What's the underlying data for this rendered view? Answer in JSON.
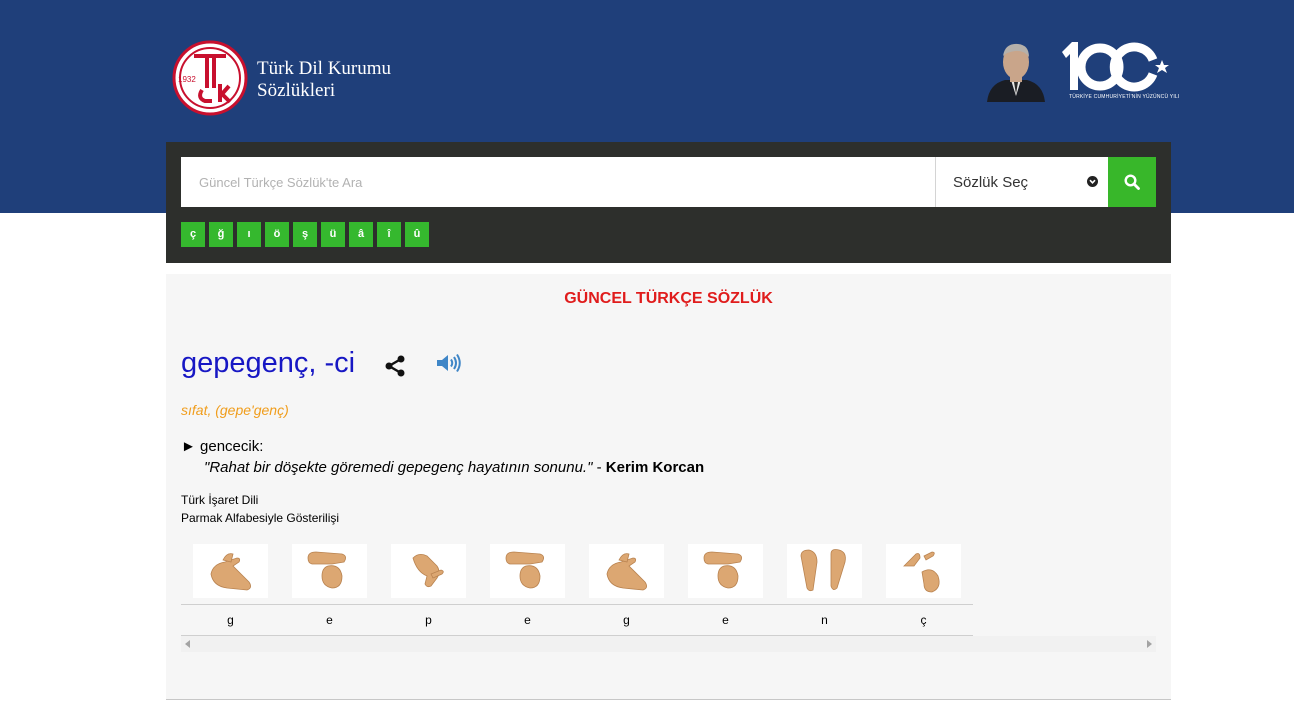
{
  "header": {
    "logo_year": "1932",
    "logo_monogram": "TDK",
    "title_line1": "Türk Dil Kurumu",
    "title_line2": "Sözlükleri",
    "centennial_mark": "100",
    "centennial_caption": "TÜRKİYE CUMHURİYETİ'NİN YÜZÜNCÜ YILI"
  },
  "search": {
    "placeholder": "Güncel Türkçe Sözlük'te Ara",
    "dictionary_select_label": "Sözlük Seç",
    "special_chars": [
      "ç",
      "ğ",
      "ı",
      "ö",
      "ş",
      "ü",
      "â",
      "î",
      "û"
    ]
  },
  "entry": {
    "dictionary_title": "GÜNCEL TÜRKÇE SÖZLÜK",
    "word": "gepegenç, -ci",
    "part_of_speech": "sıfat, (gepe'genç)",
    "meaning_marker": "►",
    "meaning": "gencecik:",
    "example_quote": "\"Rahat bir döşekte göremedi gepegenç hayatının sonunu.\"",
    "example_separator": " - ",
    "example_author": "Kerim Korcan"
  },
  "sign_language": {
    "title_line1": "Türk İşaret Dili",
    "title_line2": "Parmak Alfabesiyle Gösterilişi",
    "letters": [
      "g",
      "e",
      "p",
      "e",
      "g",
      "e",
      "n",
      "ç"
    ]
  },
  "colors": {
    "banner": "#1f3f7a",
    "search_panel": "#2d2f2c",
    "accent_green": "#38b72a",
    "dictionary_title": "#e01c1c",
    "word": "#1717c4",
    "part_of_speech": "#f09d1c",
    "speaker": "#3f86c7"
  }
}
